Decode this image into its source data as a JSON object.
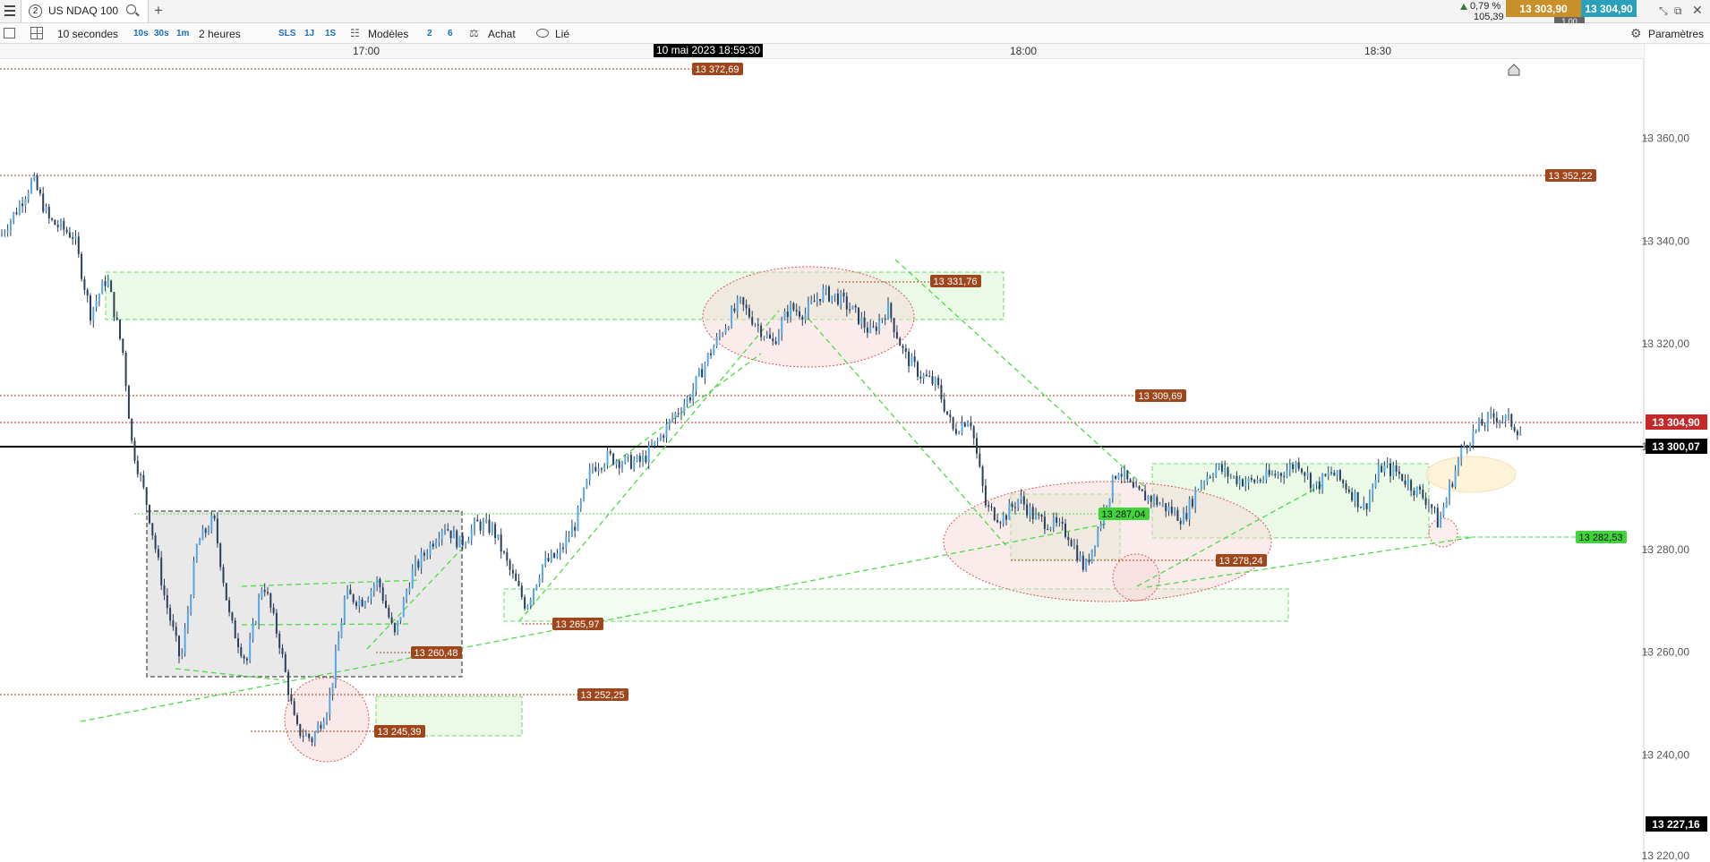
{
  "topbar": {
    "menu_icon": "menu-icon",
    "tab_number": "2",
    "instrument": "US NDAQ 100",
    "new_tab": "+",
    "change_pct": "0,79 %",
    "change_abs": "105,39",
    "bid": "13 303,90",
    "ask": "13 304,90",
    "spread": "1,00"
  },
  "toolbar": {
    "interval": "10 secondes",
    "quick_intervals": [
      "10s",
      "30s",
      "1m"
    ],
    "period": "2 heures",
    "sls": "SLS",
    "range_buttons": [
      "1J",
      "1S"
    ],
    "models": "Modèles",
    "num_buttons": [
      "2",
      "6"
    ],
    "buy": "Achat",
    "linked": "Lié",
    "settings": "Paramètres"
  },
  "timeaxis": {
    "ticks": [
      "17:00",
      "18:00",
      "18:30"
    ],
    "cursor": "10 mai 2023 18:59:30"
  },
  "chart_data": {
    "type": "candlestick",
    "ylim": [
      13218,
      13382
    ],
    "y_ticks": [
      13360,
      13340,
      13320,
      13300,
      13280,
      13260,
      13240
    ],
    "y_tick_labels": [
      "13 360,00",
      "13 340,00",
      "13 320,00",
      "13 300,00",
      "13 280,00",
      "13 260,00",
      "13 240,00"
    ],
    "y_bottom_label": "13 220,00",
    "price_tag": {
      "value": 13304.9,
      "label": "13 304,90",
      "color": "#c62828"
    },
    "crosshair_tag": {
      "value": 13300.07,
      "label": "13 300,07"
    },
    "low_tag": {
      "value": 13227.16,
      "label": "13 227,16"
    },
    "level_labels": [
      {
        "value": 13372.69,
        "label": "13 372,69"
      },
      {
        "value": 13352.22,
        "label": "13 352,22"
      },
      {
        "value": 13331.76,
        "label": "13 331,76"
      },
      {
        "value": 13309.69,
        "label": "13 309,69"
      },
      {
        "value": 13287.04,
        "label": "13 287,04"
      },
      {
        "value": 13282.53,
        "label": "13 282,53"
      },
      {
        "value": 13278.24,
        "label": "13 278,24"
      },
      {
        "value": 13265.97,
        "label": "13 265,97"
      },
      {
        "value": 13260.48,
        "label": "13 260,48"
      },
      {
        "value": 13252.25,
        "label": "13 252,25"
      },
      {
        "value": 13245.39,
        "label": "13 245,39"
      }
    ],
    "price_path": [
      [
        0,
        13341
      ],
      [
        0.01,
        13346
      ],
      [
        0.02,
        13352
      ],
      [
        0.03,
        13344
      ],
      [
        0.045,
        13341
      ],
      [
        0.055,
        13326
      ],
      [
        0.065,
        13333
      ],
      [
        0.075,
        13318
      ],
      [
        0.08,
        13301
      ],
      [
        0.09,
        13288
      ],
      [
        0.1,
        13271
      ],
      [
        0.11,
        13258
      ],
      [
        0.12,
        13281
      ],
      [
        0.13,
        13286
      ],
      [
        0.14,
        13266
      ],
      [
        0.15,
        13258
      ],
      [
        0.16,
        13274
      ],
      [
        0.17,
        13262
      ],
      [
        0.18,
        13245
      ],
      [
        0.19,
        13243
      ],
      [
        0.2,
        13250
      ],
      [
        0.21,
        13271
      ],
      [
        0.22,
        13270
      ],
      [
        0.23,
        13274
      ],
      [
        0.24,
        13263
      ],
      [
        0.25,
        13275
      ],
      [
        0.26,
        13280
      ],
      [
        0.27,
        13285
      ],
      [
        0.28,
        13281
      ],
      [
        0.29,
        13285
      ],
      [
        0.3,
        13284
      ],
      [
        0.31,
        13276
      ],
      [
        0.32,
        13269
      ],
      [
        0.33,
        13277
      ],
      [
        0.34,
        13279
      ],
      [
        0.35,
        13285
      ],
      [
        0.36,
        13296
      ],
      [
        0.37,
        13298
      ],
      [
        0.38,
        13297
      ],
      [
        0.39,
        13297
      ],
      [
        0.4,
        13301
      ],
      [
        0.41,
        13306
      ],
      [
        0.42,
        13310
      ],
      [
        0.43,
        13317
      ],
      [
        0.44,
        13323
      ],
      [
        0.45,
        13328
      ],
      [
        0.46,
        13324
      ],
      [
        0.47,
        13320
      ],
      [
        0.48,
        13327
      ],
      [
        0.49,
        13326
      ],
      [
        0.5,
        13330
      ],
      [
        0.51,
        13329
      ],
      [
        0.52,
        13326
      ],
      [
        0.53,
        13322
      ],
      [
        0.54,
        13327
      ],
      [
        0.55,
        13318
      ],
      [
        0.56,
        13314
      ],
      [
        0.57,
        13312
      ],
      [
        0.58,
        13303
      ],
      [
        0.59,
        13306
      ],
      [
        0.6,
        13288
      ],
      [
        0.61,
        13286
      ],
      [
        0.62,
        13290
      ],
      [
        0.63,
        13286
      ],
      [
        0.64,
        13285
      ],
      [
        0.65,
        13283
      ],
      [
        0.66,
        13276
      ],
      [
        0.67,
        13286
      ],
      [
        0.68,
        13296
      ],
      [
        0.69,
        13291
      ],
      [
        0.7,
        13290
      ],
      [
        0.71,
        13288
      ],
      [
        0.72,
        13286
      ],
      [
        0.73,
        13293
      ],
      [
        0.74,
        13296
      ],
      [
        0.75,
        13294
      ],
      [
        0.76,
        13293
      ],
      [
        0.77,
        13294
      ],
      [
        0.78,
        13295
      ],
      [
        0.79,
        13297
      ],
      [
        0.8,
        13292
      ],
      [
        0.81,
        13295
      ],
      [
        0.82,
        13292
      ],
      [
        0.83,
        13288
      ],
      [
        0.84,
        13296
      ],
      [
        0.85,
        13295
      ],
      [
        0.86,
        13292
      ],
      [
        0.87,
        13289
      ],
      [
        0.875,
        13285
      ],
      [
        0.88,
        13290
      ],
      [
        0.89,
        13300
      ],
      [
        0.9,
        13304
      ],
      [
        0.91,
        13306
      ],
      [
        0.918,
        13305
      ],
      [
        0.925,
        13303
      ]
    ]
  }
}
